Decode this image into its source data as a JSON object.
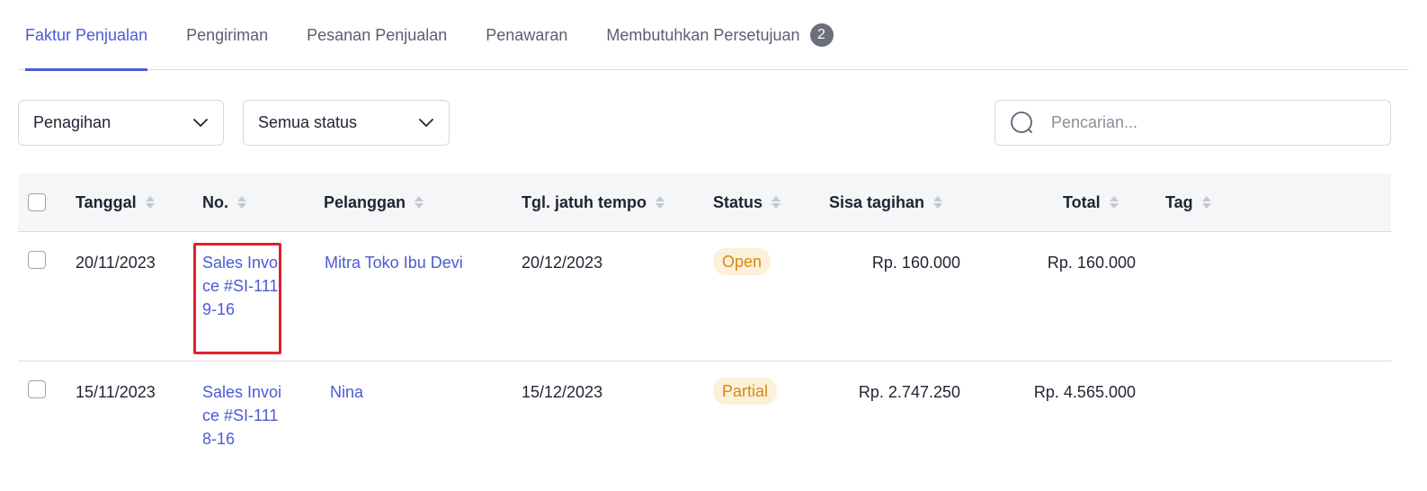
{
  "tabs": [
    {
      "label": "Faktur Penjualan",
      "active": true
    },
    {
      "label": "Pengiriman",
      "active": false
    },
    {
      "label": "Pesanan Penjualan",
      "active": false
    },
    {
      "label": "Penawaran",
      "active": false
    },
    {
      "label": "Membutuhkan Persetujuan",
      "active": false,
      "badge": "2"
    }
  ],
  "filters": {
    "billing_select": "Penagihan",
    "status_select": "Semua status",
    "search_placeholder": "Pencarian..."
  },
  "table": {
    "headers": {
      "date": "Tanggal",
      "number": "No.",
      "customer": "Pelanggan",
      "due_date": "Tgl. jatuh tempo",
      "status": "Status",
      "balance": "Sisa tagihan",
      "total": "Total",
      "tag": "Tag"
    },
    "rows": [
      {
        "date": "20/11/2023",
        "number": "Sales Invoice #SI-1119-16",
        "customer": "Mitra Toko Ibu Devi",
        "due_date": "20/12/2023",
        "status": "Open",
        "balance": "Rp. 160.000",
        "total": "Rp. 160.000",
        "tag": ""
      },
      {
        "date": "15/11/2023",
        "number": "Sales Invoice #SI-1118-16",
        "customer": "Nina",
        "due_date": "15/12/2023",
        "status": "Partial",
        "balance": "Rp. 2.747.250",
        "total": "Rp. 4.565.000",
        "tag": ""
      }
    ]
  },
  "colors": {
    "accent": "#4a5bd4",
    "status_badge_bg": "#fdf0d9",
    "status_badge_text": "#d48a10",
    "highlight": "#e0202a"
  },
  "icons": {
    "select_chevron": "chevron-down-icon",
    "search": "search-icon",
    "sort": "sort-icon"
  }
}
